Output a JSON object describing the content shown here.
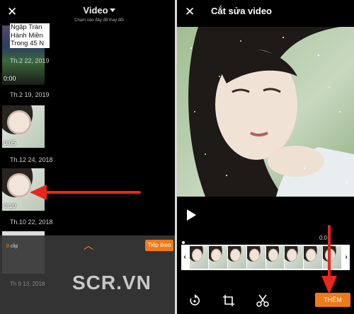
{
  "left": {
    "title": "Video",
    "subtitle": "Chạm vào đây để thay đổi",
    "ad_text": "Ngập Tràn Hành Miền Trong 45 N",
    "videos": [
      {
        "duration": "0:00",
        "date": "Th.2 22, 2019"
      },
      {
        "duration": "",
        "date": "Th.2 19, 2019"
      },
      {
        "duration": "0:05",
        "date": "Th.12 24, 2018"
      },
      {
        "duration": "0:10",
        "date": "Th.10 22, 2018"
      }
    ],
    "tray": {
      "clip_count_num": "0",
      "clip_count_word": "clip",
      "next_label": "Tiếp theo",
      "bottom_date": "Th 9 13, 2018"
    },
    "watermark": "SCR.VN"
  },
  "right": {
    "title": "Cắt sửa video",
    "time": "0:0",
    "add_label": "THÊM",
    "handle_left": "‹",
    "handle_right": "›"
  },
  "icons": [
    "close-icon",
    "caret-down-icon",
    "chevron-up-icon",
    "play-icon",
    "rotate-icon",
    "crop-icon",
    "scissors-icon"
  ],
  "colors": {
    "accent": "#f07a18",
    "arrow": "#e8261b",
    "background": "#000000"
  }
}
